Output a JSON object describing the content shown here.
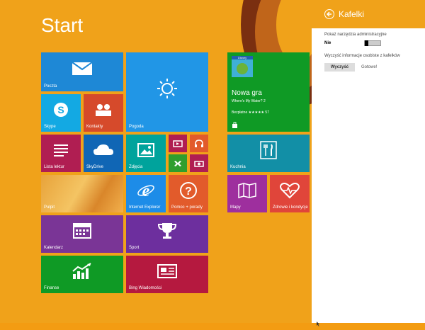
{
  "start": {
    "title": "Start"
  },
  "tiles": {
    "poczta": "Poczta",
    "pogoda": "Pogoda",
    "skype": "Skype",
    "kontakty": "Kontakty",
    "lista_lektur": "Lista lektur",
    "skydrive": "SkyDrive",
    "zdjecia": "Zdjęcia",
    "pulpit": "Pulpit",
    "internet_explorer": "Internet Explorer",
    "pomoc": "Pomoc + porady",
    "kalendarz": "Kalendarz",
    "sport": "Sport",
    "finanse": "Finanse",
    "bing_wiadomosci": "Bing Wiadomości",
    "kuchnia": "Kuchnia",
    "mapy": "Mapy",
    "zdrowie": "Zdrowie i kondycje",
    "store": {
      "heading": "Nowa gra",
      "game": "Where's My Water? 2",
      "price": "Bezpłatne ★★★★★ 57",
      "badge": "Disney"
    }
  },
  "panel": {
    "title": "Kafelki",
    "admin_label": "Pokaż narzędzia administracyjne",
    "admin_value": "Nie",
    "clear_label": "Wyczyść informacje osobiste z kafelków",
    "clear_button": "Wyczyść",
    "done_text": "Gotowe!"
  },
  "colors": {
    "background": "#f0a21a",
    "mail": "#1e88d6",
    "weather": "#2196e6",
    "skype": "#13a9e3",
    "people": "#d64a2b",
    "reading": "#b01e52",
    "skydrive": "#1066b5",
    "photos": "#00a39c",
    "small_red": "#b01e52",
    "small_green": "#2e9e2e",
    "ie": "#1d8ce8",
    "help": "#e25b2b",
    "calendar": "#7a3596",
    "sport": "#6d2f9e",
    "finance": "#0f9a25",
    "bing_news": "#b5193f",
    "store": "#0f9a25",
    "kitchen": "#128fa6",
    "maps": "#9e2f9e",
    "health": "#e0453a"
  }
}
